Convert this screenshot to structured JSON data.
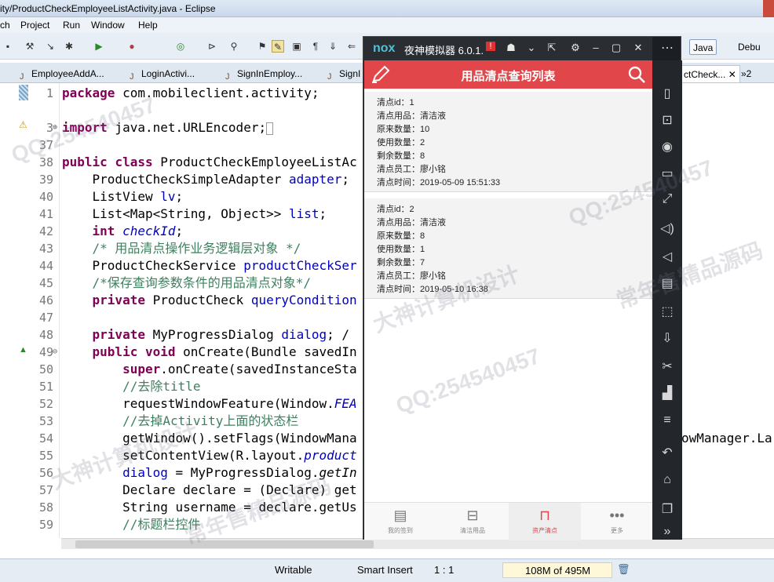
{
  "window": {
    "title": "ity/ProductCheckEmployeeListActivity.java - Eclipse"
  },
  "menu": [
    "ch",
    "Project",
    "Run",
    "Window",
    "Help"
  ],
  "perspectives": {
    "java": "Java",
    "debug": "Debu"
  },
  "editor_tabs": [
    {
      "label": "EmployeeAddA..."
    },
    {
      "label": "LoginActivi..."
    },
    {
      "label": "SignInEmploy..."
    },
    {
      "label": "SignI"
    },
    {
      "label": "ctCheck..."
    },
    {
      "label": "»2"
    }
  ],
  "code_lines": [
    {
      "num": "1",
      "text": "package com.mobileclient.activity;"
    },
    {
      "num": "2",
      "text": ""
    },
    {
      "num": "3",
      "text": "import java.net.URLEncoder;"
    },
    {
      "num": "37",
      "text": ""
    },
    {
      "num": "38",
      "text": "public class ProductCheckEmployeeListAc"
    },
    {
      "num": "39",
      "text": "ProductCheckSimpleAdapter adapter;"
    },
    {
      "num": "40",
      "text": "ListView lv;"
    },
    {
      "num": "41",
      "text": "List<Map<String, Object>> list;"
    },
    {
      "num": "42",
      "text": "int checkId;"
    },
    {
      "num": "43",
      "text": "/* 用品清点操作业务逻辑层对象 */"
    },
    {
      "num": "44",
      "text": "ProductCheckService productCheckSer"
    },
    {
      "num": "45",
      "text": "/*保存查询参数条件的用品清点对象*/"
    },
    {
      "num": "46",
      "text": "private ProductCheck queryCondition"
    },
    {
      "num": "47",
      "text": ""
    },
    {
      "num": "48",
      "text": "private MyProgressDialog dialog; /"
    },
    {
      "num": "49",
      "text": "public void onCreate(Bundle savedIn"
    },
    {
      "num": "50",
      "text": "super.onCreate(savedInstanceSta"
    },
    {
      "num": "51",
      "text": "//去除title"
    },
    {
      "num": "52",
      "text": "requestWindowFeature(Window.FEA"
    },
    {
      "num": "53",
      "text": "//去掉Activity上面的状态栏"
    },
    {
      "num": "54",
      "text": "getWindow().setFlags(WindowMana"
    },
    {
      "num": "55",
      "text": "setContentView(R.layout.product"
    },
    {
      "num": "56",
      "text": "dialog = MyProgressDialog.getIn"
    },
    {
      "num": "57",
      "text": "Declare declare = (Declare) get"
    },
    {
      "num": "58",
      "text": "String username = declare.getUs"
    },
    {
      "num": "59",
      "text": "//标题栏控件"
    }
  ],
  "code_overflow": "owManager.La",
  "status": {
    "writable": "Writable",
    "insert": "Smart Insert",
    "position": "1 : 1",
    "heap": "108M of 495M"
  },
  "emulator": {
    "logo": "nox",
    "name": "夜神模拟器 6.0.1.",
    "app_title": "用品清点查询列表",
    "records": [
      {
        "lines": [
          "清点id：1",
          "清点用品：清洁液",
          "原来数量：10",
          "使用数量：2",
          "剩余数量：8",
          "清点员工：廖小铭",
          "清点时间：2019-05-09 15:51:33"
        ]
      },
      {
        "lines": [
          "清点id：2",
          "清点用品：清洁液",
          "原来数量：8",
          "使用数量：1",
          "剩余数量：7",
          "清点员工：廖小铭",
          "清点时间：2019-05-10   16:38"
        ]
      }
    ],
    "nav": [
      {
        "label": "我的签到",
        "icon": "film-icon"
      },
      {
        "label": "清洁用品",
        "icon": "tray-icon"
      },
      {
        "label": "资产清点",
        "icon": "bag-icon"
      },
      {
        "label": "更多",
        "icon": "more-icon"
      }
    ],
    "accent": "#e0464a"
  },
  "watermarks": [
    "QQ:254540457",
    "大神计算机设计",
    "常年售精品源码"
  ]
}
